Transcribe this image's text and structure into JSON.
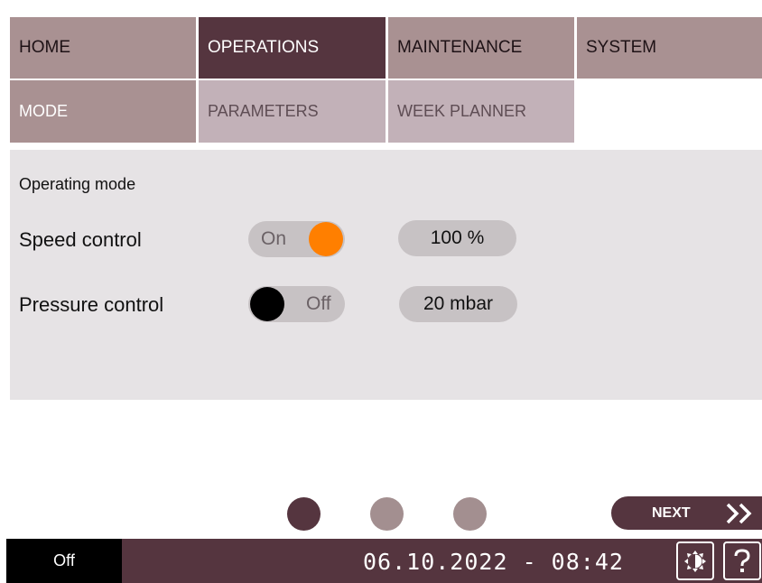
{
  "nav": {
    "main_tabs": [
      {
        "label": "HOME",
        "active": false
      },
      {
        "label": "OPERATIONS",
        "active": true
      },
      {
        "label": "MAINTENANCE",
        "active": false
      },
      {
        "label": "SYSTEM",
        "active": false
      }
    ],
    "sub_tabs": [
      {
        "label": "MODE",
        "active": true
      },
      {
        "label": "PARAMETERS",
        "active": false
      },
      {
        "label": "WEEK PLANNER",
        "active": false
      }
    ]
  },
  "panel": {
    "title": "Operating mode",
    "rows": [
      {
        "label": "Speed control",
        "toggle_state": "On",
        "toggle_on": true,
        "value": "100 %"
      },
      {
        "label": "Pressure control",
        "toggle_state": "Off",
        "toggle_on": false,
        "value": "20 mbar"
      }
    ]
  },
  "pager": {
    "page_count": 3,
    "current_page": 1
  },
  "next_button": {
    "label": "NEXT",
    "icon": "double-chevron-right-icon"
  },
  "status_bar": {
    "state": "Off",
    "datetime": "06.10.2022 - 08:42",
    "icons": [
      "brightness-icon",
      "help-icon"
    ]
  },
  "colors": {
    "main_tab_bg": "#a99192",
    "active_tab_bg": "#55353f",
    "sub_tab_bg": "#c2b1b8",
    "active_sub_tab_bg": "#a99192",
    "panel_bg": "#e6e3e5",
    "pill_bg": "#c7c2c4",
    "accent_orange": "#ff7f00",
    "dot_active": "#55353f",
    "dot_inactive": "#a38f90",
    "status_bg": "#55353f"
  }
}
